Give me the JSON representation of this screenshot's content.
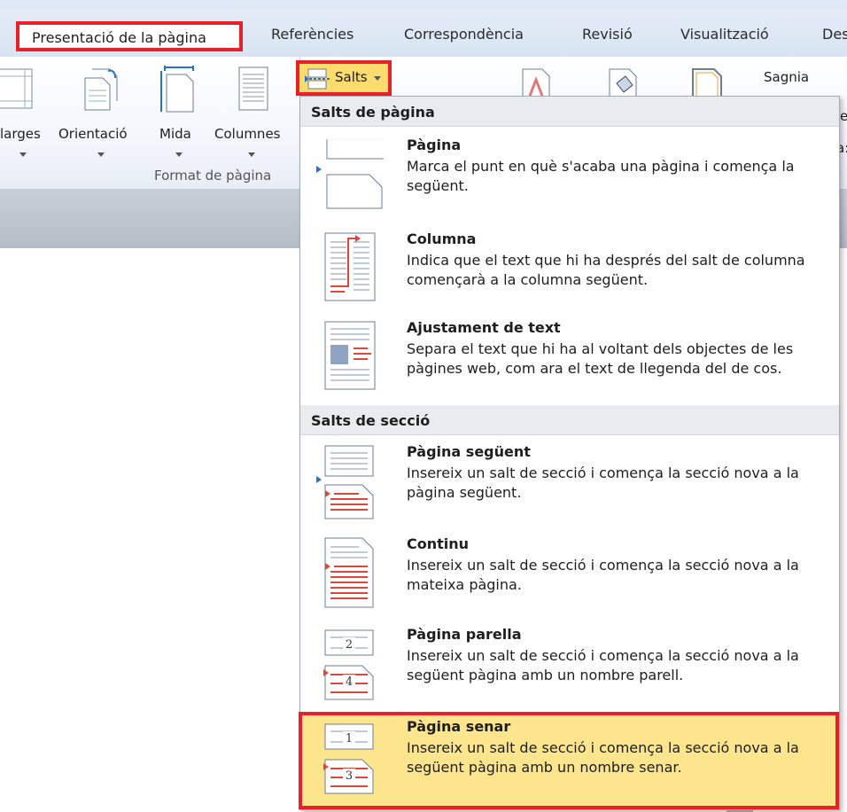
{
  "tabs": [
    {
      "label": "Presentació de la pàgina"
    },
    {
      "label": "Referències"
    },
    {
      "label": "Correspondència"
    },
    {
      "label": "Revisió"
    },
    {
      "label": "Visualització"
    },
    {
      "label": "Des"
    }
  ],
  "ribbon": {
    "margins_label": "larges",
    "orientation_label": "Orientació",
    "size_label": "Mida",
    "columns_label": "Columnes",
    "group_label": "Format de pàgina",
    "breaks_label": "Salts",
    "indent_label": "Sagnia",
    "clip_e": "e",
    "clip_colon": "a:"
  },
  "menu": {
    "page_breaks_header": "Salts de pàgina",
    "section_breaks_header": "Salts de secció",
    "items": [
      {
        "title": "Pàgina",
        "desc": "Marca el punt en què s'acaba una pàgina i comença la següent."
      },
      {
        "title": "Columna",
        "desc": "Indica que el text que hi ha després del salt de columna començarà a la columna següent."
      },
      {
        "title": "Ajustament de text",
        "desc": "Separa el text que hi ha al voltant dels objectes de les pàgines web, com ara el text de llegenda del de cos."
      },
      {
        "title": "Pàgina següent",
        "desc": "Insereix un salt de secció i comença la secció nova a la pàgina següent."
      },
      {
        "title": "Continu",
        "desc": "Insereix un salt de secció i comença la secció nova a la mateixa pàgina."
      },
      {
        "title": "Pàgina parella",
        "desc": "Insereix un salt de secció i comença la secció nova a la següent pàgina amb un nombre parell.",
        "num_top": "2",
        "num_bottom": "4"
      },
      {
        "title": "Pàgina senar",
        "desc": "Insereix un salt de secció i comença la secció nova a la següent pàgina amb un nombre senar.",
        "num_top": "1",
        "num_bottom": "3"
      }
    ]
  },
  "colors": {
    "highlight": "#fce58c",
    "annotation_red": "#e8202a",
    "accent_blue": "#2a72c9"
  }
}
